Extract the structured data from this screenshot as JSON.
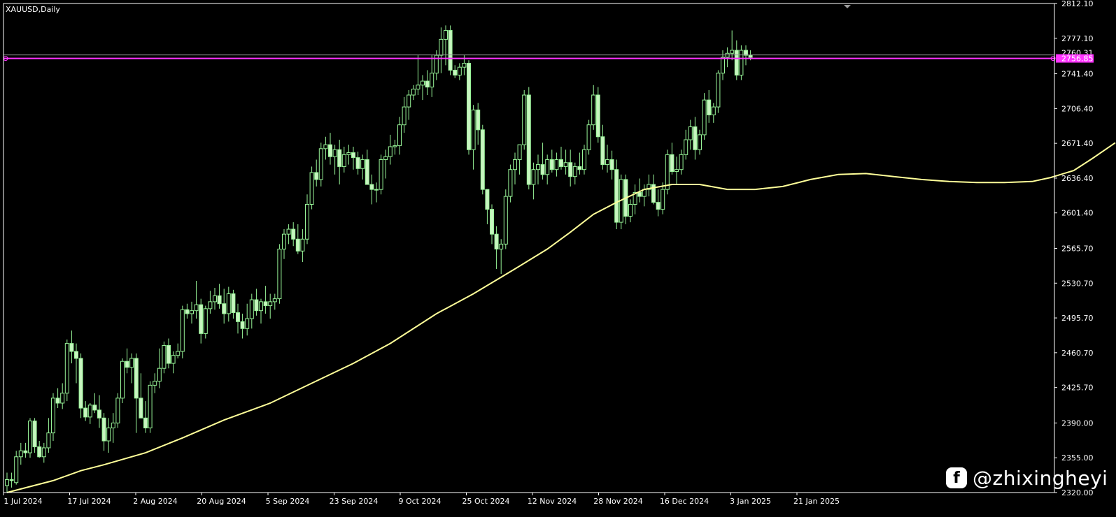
{
  "window": {
    "title": "XAUUSD,Daily"
  },
  "watermark": {
    "text": "@zhixingheyi",
    "logo_icon": "social-logo-icon"
  },
  "colors": {
    "background": "#000000",
    "candle": "#98f598",
    "candle_fill_bull": "#000000",
    "candle_fill_bear": "#c8f5c0",
    "moving_average": "#ffff99",
    "level_line": "#ff33ff",
    "bid_line": "#9a9a9a",
    "axis_text": "#ffffff"
  },
  "chart_data": {
    "type": "candlestick",
    "symbol": "XAUUSD",
    "timeframe": "Daily",
    "ylim": [
      2320.0,
      2812.1
    ],
    "y_ticks": [
      "2812.10",
      "2777.10",
      "2741.40",
      "2706.40",
      "2671.40",
      "2636.40",
      "2601.40",
      "2565.70",
      "2530.70",
      "2495.70",
      "2460.70",
      "2425.70",
      "2390.00",
      "2355.00",
      "2320.00"
    ],
    "x_ticks": [
      "1 Jul 2024",
      "17 Jul 2024",
      "2 Aug 2024",
      "20 Aug 2024",
      "5 Sep 2024",
      "23 Sep 2024",
      "9 Oct 2024",
      "25 Oct 2024",
      "12 Nov 2024",
      "28 Nov 2024",
      "16 Dec 2024",
      "3 Jan 2025",
      "21 Jan 2025"
    ],
    "price_labels": {
      "bid": {
        "text": "2760.31",
        "value": 2760.31
      },
      "level": {
        "text": "2756.85",
        "value": 2756.85
      }
    },
    "candles": [
      [
        2327,
        2340,
        2320,
        2333
      ],
      [
        2333,
        2340,
        2325,
        2332
      ],
      [
        2330,
        2362,
        2328,
        2356
      ],
      [
        2356,
        2370,
        2348,
        2362
      ],
      [
        2362,
        2370,
        2355,
        2360
      ],
      [
        2360,
        2395,
        2355,
        2392
      ],
      [
        2392,
        2395,
        2360,
        2366
      ],
      [
        2366,
        2372,
        2355,
        2356
      ],
      [
        2356,
        2370,
        2350,
        2365
      ],
      [
        2365,
        2395,
        2360,
        2380
      ],
      [
        2380,
        2420,
        2372,
        2415
      ],
      [
        2415,
        2425,
        2405,
        2410
      ],
      [
        2410,
        2430,
        2404,
        2420
      ],
      [
        2420,
        2474,
        2412,
        2470
      ],
      [
        2470,
        2483,
        2450,
        2462
      ],
      [
        2462,
        2470,
        2430,
        2455
      ],
      [
        2455,
        2460,
        2395,
        2405
      ],
      [
        2405,
        2412,
        2392,
        2396
      ],
      [
        2396,
        2410,
        2389,
        2408
      ],
      [
        2408,
        2420,
        2400,
        2403
      ],
      [
        2403,
        2418,
        2385,
        2395
      ],
      [
        2395,
        2400,
        2362,
        2372
      ],
      [
        2372,
        2395,
        2360,
        2385
      ],
      [
        2385,
        2400,
        2370,
        2390
      ],
      [
        2390,
        2420,
        2385,
        2415
      ],
      [
        2415,
        2455,
        2410,
        2452
      ],
      [
        2452,
        2465,
        2440,
        2446
      ],
      [
        2446,
        2460,
        2430,
        2455
      ],
      [
        2455,
        2460,
        2380,
        2415
      ],
      [
        2415,
        2440,
        2402,
        2395
      ],
      [
        2395,
        2412,
        2380,
        2385
      ],
      [
        2385,
        2432,
        2380,
        2428
      ],
      [
        2428,
        2440,
        2420,
        2432
      ],
      [
        2432,
        2465,
        2425,
        2445
      ],
      [
        2445,
        2472,
        2440,
        2468
      ],
      [
        2468,
        2475,
        2445,
        2450
      ],
      [
        2450,
        2462,
        2440,
        2458
      ],
      [
        2458,
        2470,
        2455,
        2462
      ],
      [
        2462,
        2508,
        2455,
        2504
      ],
      [
        2504,
        2510,
        2495,
        2500
      ],
      [
        2500,
        2512,
        2490,
        2503
      ],
      [
        2503,
        2533,
        2495,
        2509
      ],
      [
        2509,
        2515,
        2470,
        2480
      ],
      [
        2480,
        2508,
        2475,
        2505
      ],
      [
        2505,
        2523,
        2500,
        2512
      ],
      [
        2512,
        2526,
        2504,
        2518
      ],
      [
        2518,
        2530,
        2505,
        2510
      ],
      [
        2510,
        2525,
        2490,
        2500
      ],
      [
        2500,
        2527,
        2492,
        2520
      ],
      [
        2520,
        2524,
        2495,
        2501
      ],
      [
        2501,
        2510,
        2480,
        2492
      ],
      [
        2492,
        2500,
        2475,
        2485
      ],
      [
        2485,
        2510,
        2478,
        2495
      ],
      [
        2495,
        2520,
        2485,
        2514
      ],
      [
        2514,
        2525,
        2498,
        2503
      ],
      [
        2503,
        2515,
        2490,
        2512
      ],
      [
        2512,
        2528,
        2500,
        2508
      ],
      [
        2508,
        2520,
        2495,
        2512
      ],
      [
        2512,
        2520,
        2504,
        2515
      ],
      [
        2515,
        2570,
        2510,
        2565
      ],
      [
        2565,
        2585,
        2555,
        2580
      ],
      [
        2580,
        2590,
        2570,
        2585
      ],
      [
        2585,
        2592,
        2568,
        2575
      ],
      [
        2575,
        2590,
        2560,
        2563
      ],
      [
        2563,
        2585,
        2552,
        2575
      ],
      [
        2575,
        2620,
        2570,
        2610
      ],
      [
        2610,
        2648,
        2605,
        2642
      ],
      [
        2642,
        2655,
        2628,
        2635
      ],
      [
        2635,
        2672,
        2628,
        2666
      ],
      [
        2666,
        2678,
        2655,
        2670
      ],
      [
        2670,
        2682,
        2650,
        2658
      ],
      [
        2658,
        2670,
        2640,
        2665
      ],
      [
        2665,
        2675,
        2630,
        2648
      ],
      [
        2648,
        2668,
        2642,
        2660
      ],
      [
        2660,
        2670,
        2650,
        2662
      ],
      [
        2662,
        2668,
        2645,
        2657
      ],
      [
        2657,
        2663,
        2640,
        2646
      ],
      [
        2646,
        2660,
        2635,
        2655
      ],
      [
        2655,
        2665,
        2630,
        2630
      ],
      [
        2630,
        2640,
        2610,
        2625
      ],
      [
        2625,
        2632,
        2612,
        2625
      ],
      [
        2625,
        2660,
        2620,
        2655
      ],
      [
        2655,
        2665,
        2636,
        2658
      ],
      [
        2658,
        2680,
        2650,
        2668
      ],
      [
        2668,
        2675,
        2660,
        2669
      ],
      [
        2669,
        2698,
        2660,
        2690
      ],
      [
        2690,
        2718,
        2682,
        2708
      ],
      [
        2708,
        2725,
        2695,
        2720
      ],
      [
        2720,
        2730,
        2715,
        2726
      ],
      [
        2726,
        2760,
        2720,
        2730
      ],
      [
        2730,
        2740,
        2715,
        2734
      ],
      [
        2734,
        2745,
        2720,
        2728
      ],
      [
        2728,
        2760,
        2718,
        2742
      ],
      [
        2742,
        2765,
        2735,
        2760
      ],
      [
        2760,
        2788,
        2742,
        2776
      ],
      [
        2776,
        2790,
        2750,
        2785
      ],
      [
        2785,
        2790,
        2740,
        2745
      ],
      [
        2745,
        2750,
        2737,
        2740
      ],
      [
        2740,
        2752,
        2735,
        2748
      ],
      [
        2748,
        2760,
        2740,
        2752
      ],
      [
        2752,
        2755,
        2660,
        2665
      ],
      [
        2665,
        2710,
        2645,
        2705
      ],
      [
        2705,
        2712,
        2670,
        2685
      ],
      [
        2685,
        2690,
        2620,
        2625
      ],
      [
        2625,
        2625,
        2590,
        2605
      ],
      [
        2605,
        2610,
        2570,
        2580
      ],
      [
        2580,
        2588,
        2545,
        2565
      ],
      [
        2565,
        2575,
        2540,
        2570
      ],
      [
        2570,
        2625,
        2565,
        2618
      ],
      [
        2618,
        2650,
        2612,
        2645
      ],
      [
        2645,
        2662,
        2630,
        2655
      ],
      [
        2655,
        2670,
        2640,
        2670
      ],
      [
        2670,
        2725,
        2665,
        2720
      ],
      [
        2720,
        2728,
        2625,
        2630
      ],
      [
        2630,
        2652,
        2615,
        2645
      ],
      [
        2645,
        2660,
        2630,
        2650
      ],
      [
        2650,
        2672,
        2635,
        2640
      ],
      [
        2640,
        2660,
        2630,
        2655
      ],
      [
        2655,
        2665,
        2642,
        2645
      ],
      [
        2645,
        2662,
        2638,
        2655
      ],
      [
        2655,
        2668,
        2645,
        2648
      ],
      [
        2648,
        2665,
        2640,
        2652
      ],
      [
        2652,
        2665,
        2628,
        2638
      ],
      [
        2638,
        2652,
        2630,
        2648
      ],
      [
        2648,
        2662,
        2640,
        2645
      ],
      [
        2645,
        2670,
        2640,
        2665
      ],
      [
        2665,
        2695,
        2660,
        2690
      ],
      [
        2690,
        2730,
        2685,
        2720
      ],
      [
        2720,
        2728,
        2672,
        2678
      ],
      [
        2678,
        2690,
        2645,
        2650
      ],
      [
        2650,
        2670,
        2642,
        2655
      ],
      [
        2655,
        2664,
        2635,
        2645
      ],
      [
        2645,
        2655,
        2585,
        2592
      ],
      [
        2592,
        2640,
        2585,
        2635
      ],
      [
        2635,
        2640,
        2590,
        2598
      ],
      [
        2598,
        2615,
        2592,
        2610
      ],
      [
        2610,
        2630,
        2600,
        2622
      ],
      [
        2622,
        2636,
        2612,
        2618
      ],
      [
        2618,
        2630,
        2608,
        2625
      ],
      [
        2625,
        2640,
        2618,
        2630
      ],
      [
        2630,
        2640,
        2610,
        2612
      ],
      [
        2612,
        2625,
        2598,
        2605
      ],
      [
        2605,
        2632,
        2600,
        2625
      ],
      [
        2625,
        2665,
        2620,
        2660
      ],
      [
        2660,
        2672,
        2640,
        2643
      ],
      [
        2643,
        2658,
        2630,
        2645
      ],
      [
        2645,
        2665,
        2640,
        2660
      ],
      [
        2660,
        2685,
        2655,
        2675
      ],
      [
        2675,
        2695,
        2665,
        2688
      ],
      [
        2688,
        2698,
        2655,
        2665
      ],
      [
        2665,
        2685,
        2660,
        2680
      ],
      [
        2680,
        2722,
        2675,
        2715
      ],
      [
        2715,
        2725,
        2692,
        2700
      ],
      [
        2700,
        2712,
        2692,
        2708
      ],
      [
        2708,
        2745,
        2702,
        2742
      ],
      [
        2742,
        2765,
        2735,
        2758
      ],
      [
        2758,
        2768,
        2748,
        2762
      ],
      [
        2762,
        2785,
        2755,
        2765
      ],
      [
        2765,
        2775,
        2735,
        2740
      ],
      [
        2740,
        2770,
        2735,
        2765
      ],
      [
        2765,
        2770,
        2750,
        2760
      ],
      [
        2760,
        2765,
        2755,
        2758
      ]
    ],
    "moving_average": {
      "name": "",
      "points": [
        [
          0,
          2320
        ],
        [
          10,
          2332
        ],
        [
          16,
          2342
        ],
        [
          21,
          2348
        ],
        [
          30,
          2360
        ],
        [
          38,
          2375
        ],
        [
          47,
          2393
        ],
        [
          57,
          2410
        ],
        [
          66,
          2430
        ],
        [
          75,
          2450
        ],
        [
          83,
          2470
        ],
        [
          93,
          2500
        ],
        [
          101,
          2520
        ],
        [
          110,
          2545
        ],
        [
          117,
          2565
        ],
        [
          122,
          2582
        ],
        [
          127,
          2600
        ],
        [
          132,
          2612
        ],
        [
          138,
          2625
        ],
        [
          144,
          2630
        ],
        [
          150,
          2630
        ],
        [
          156,
          2625
        ],
        [
          162,
          2625
        ],
        [
          168,
          2628
        ],
        [
          174,
          2635
        ],
        [
          180,
          2640
        ],
        [
          186,
          2641
        ],
        [
          192,
          2638
        ],
        [
          198,
          2635
        ],
        [
          204,
          2633
        ],
        [
          210,
          2632
        ],
        [
          216,
          2632
        ],
        [
          222,
          2633
        ],
        [
          226,
          2637
        ],
        [
          231,
          2644
        ],
        [
          235,
          2656
        ],
        [
          240,
          2672
        ]
      ]
    }
  }
}
